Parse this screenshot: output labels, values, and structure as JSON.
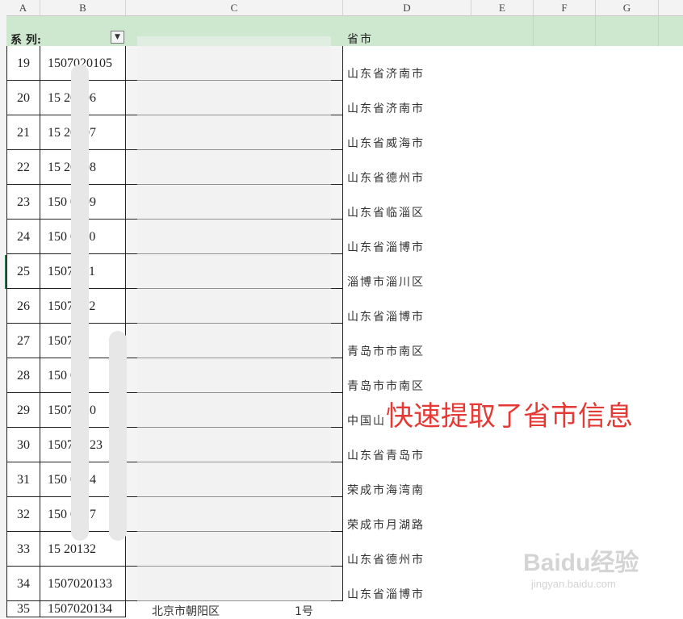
{
  "columns": [
    "A",
    "B",
    "C",
    "D",
    "E",
    "F",
    "G"
  ],
  "header_row": {
    "series_label": "系 列:",
    "filter_icon": "dropdown-arrow-icon",
    "province_label": "省市"
  },
  "rows": [
    {
      "n": "19",
      "id": "1507020105",
      "place": "山东省济南市"
    },
    {
      "n": "20",
      "id": "15   20106",
      "place": "山东省济南市"
    },
    {
      "n": "21",
      "id": "15   20107",
      "place": "山东省威海市"
    },
    {
      "n": "22",
      "id": "15   20108",
      "place": "山东省德州市"
    },
    {
      "n": "23",
      "id": "150   0109",
      "place": "山东省临淄区"
    },
    {
      "n": "24",
      "id": "150   0110",
      "place": "山东省淄博市"
    },
    {
      "n": "25",
      "id": "1507   111",
      "place": "淄博市淄川区"
    },
    {
      "n": "26",
      "id": "1507   112",
      "place": "山东省淄博市"
    },
    {
      "n": "27",
      "id": "1507   11",
      "place": "青岛市市南区"
    },
    {
      "n": "28",
      "id": "150   011",
      "place": "青岛市市南区"
    },
    {
      "n": "29",
      "id": "1507   120",
      "place": "中国山"
    },
    {
      "n": "30",
      "id": "1507   0123",
      "place": "山东省青岛市"
    },
    {
      "n": "31",
      "id": "150   0124",
      "place": "荣成市海湾南"
    },
    {
      "n": "32",
      "id": "150   0127",
      "place": "荣成市月湖路"
    },
    {
      "n": "33",
      "id": "15   20132",
      "place": "山东省德州市"
    },
    {
      "n": "34",
      "id": "1507020133",
      "place": "山东省淄博市"
    }
  ],
  "partial_row": {
    "n": "35",
    "id": "1507020134",
    "c": "北京市朝阳区",
    "c_end": "1号"
  },
  "annotation": "快速提取了省市信息",
  "watermark": {
    "logo": "Baidu经验",
    "url": "jingyan.baidu.com"
  },
  "colors": {
    "header_green": "#cde8cf",
    "annotation_red": "#e53935",
    "grid": "#222222"
  }
}
